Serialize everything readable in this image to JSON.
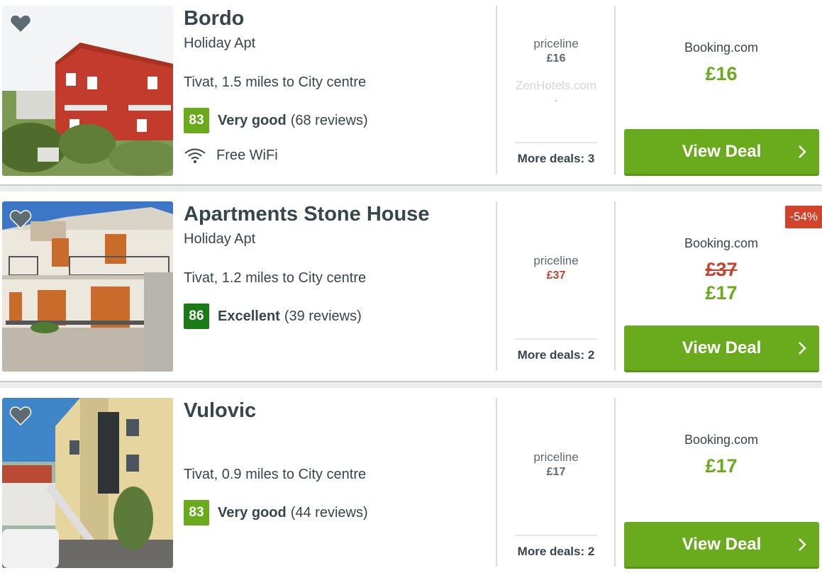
{
  "listings": [
    {
      "name": "Bordo",
      "type": "Holiday Apt",
      "location": "Tivat, 1.5 miles to City centre",
      "score": "83",
      "rating": "Very good",
      "reviews": "(68 reviews)",
      "amenity": "Free WiFi",
      "providers": [
        {
          "name": "priceline",
          "price": "£16"
        },
        {
          "name": "ZenHotels.com",
          "price": "-"
        }
      ],
      "more_deals": "More deals: 3",
      "best_provider": "Booking.com",
      "price": "£16",
      "cta": "View Deal"
    },
    {
      "name": "Apartments Stone House",
      "type": "Holiday Apt",
      "location": "Tivat, 1.2 miles to City centre",
      "score": "86",
      "rating": "Excellent",
      "reviews": "(39 reviews)",
      "providers": [
        {
          "name": "priceline",
          "price": "£37"
        }
      ],
      "more_deals": "More deals: 2",
      "discount": "-54%",
      "best_provider": "Booking.com",
      "old_price": "£37",
      "price": "£17",
      "cta": "View Deal"
    },
    {
      "name": "Vulovic",
      "location": "Tivat, 0.9 miles to City centre",
      "score": "83",
      "rating": "Very good",
      "reviews": "(44 reviews)",
      "providers": [
        {
          "name": "priceline",
          "price": "£17"
        }
      ],
      "more_deals": "More deals: 2",
      "best_provider": "Booking.com",
      "price": "£17",
      "cta": "View Deal"
    }
  ],
  "colors": {
    "accent_green": "#6aab1e",
    "excellent_green": "#1b7c17",
    "discount_red": "#d2432c"
  },
  "icons": [
    "heart-icon",
    "wifi-icon",
    "chevron-right-icon"
  ]
}
